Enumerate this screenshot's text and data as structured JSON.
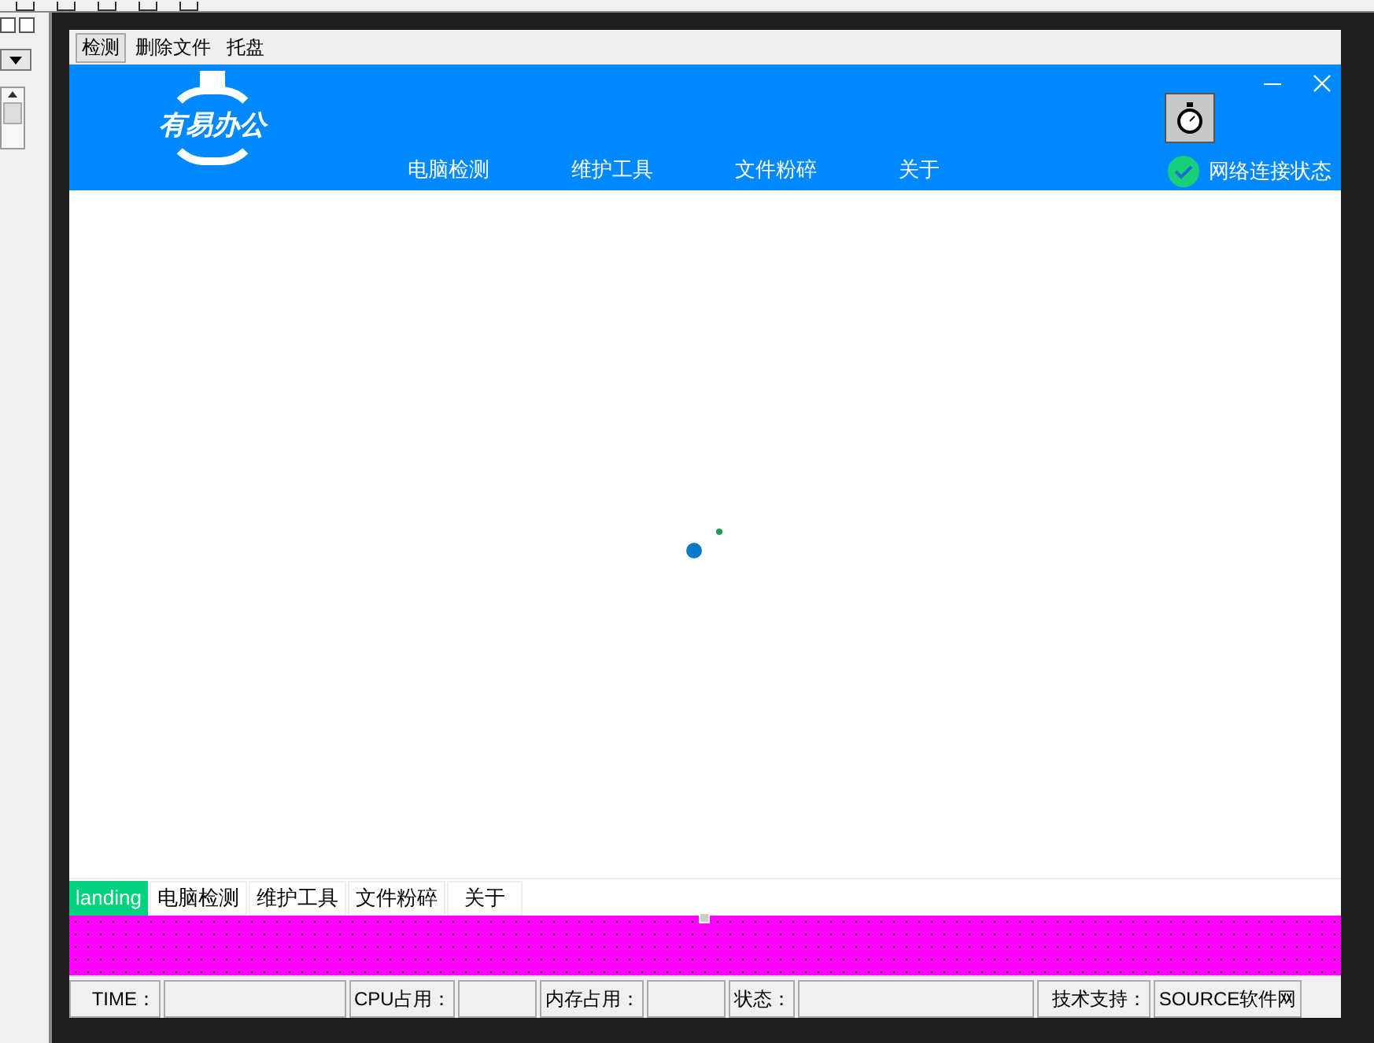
{
  "menu": [
    {
      "label": "检测",
      "selected": true
    },
    {
      "label": "删除文件",
      "selected": false
    },
    {
      "label": "托盘",
      "selected": false
    }
  ],
  "header": {
    "logo_text": "有易办公",
    "nav": [
      "电脑检测",
      "维护工具",
      "文件粉碎",
      "关于"
    ],
    "network_status": {
      "label": "网络连接状态",
      "connected": true
    }
  },
  "tabs": [
    {
      "label": "landing",
      "selected": true
    },
    {
      "label": "电脑检测",
      "selected": false
    },
    {
      "label": "维护工具",
      "selected": false
    },
    {
      "label": "文件粉碎",
      "selected": false
    },
    {
      "label": "关于",
      "selected": false
    }
  ],
  "status_bar": [
    {
      "label": "TIME："
    },
    {
      "label": "CPU占用："
    },
    {
      "label": "内存占用："
    },
    {
      "label": "状态："
    },
    {
      "label": "技术支持："
    },
    {
      "label": "SOURCE软件网"
    }
  ]
}
